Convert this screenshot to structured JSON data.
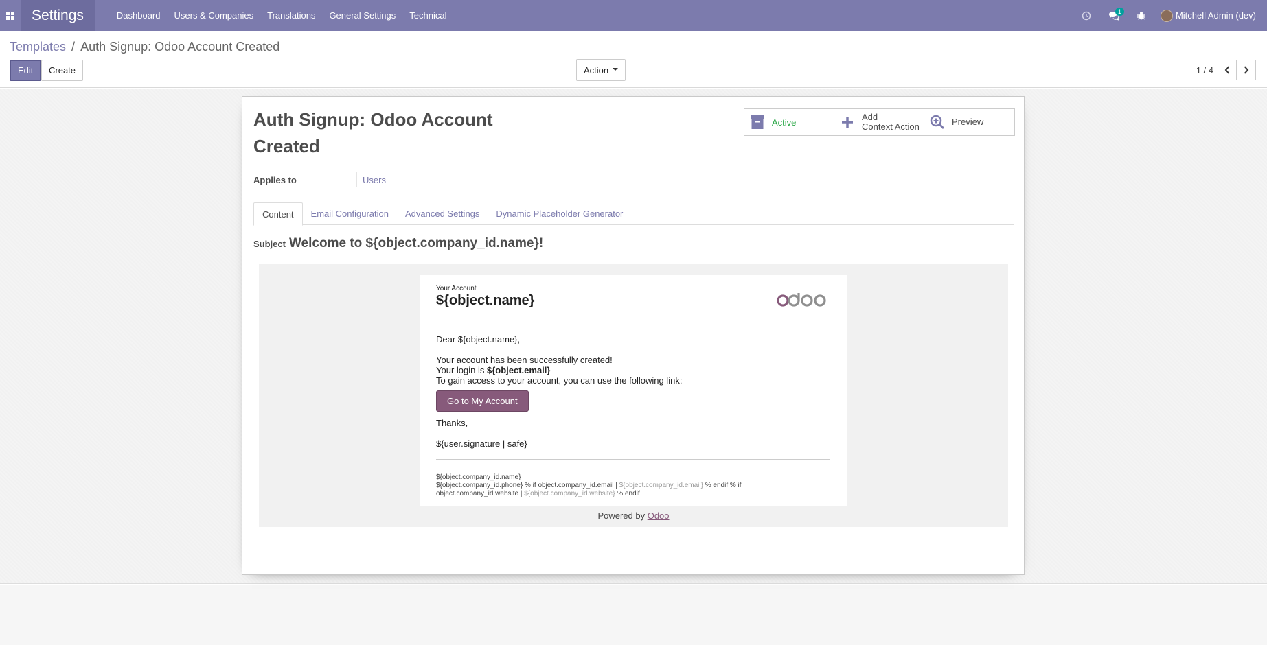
{
  "navbar": {
    "app_title": "Settings",
    "menu": [
      "Dashboard",
      "Users & Companies",
      "Translations",
      "General Settings",
      "Technical"
    ],
    "chat_badge": "1",
    "user_name": "Mitchell Admin (dev)"
  },
  "control_panel": {
    "breadcrumb_parent": "Templates",
    "breadcrumb_separator": "/",
    "breadcrumb_current": "Auth Signup: Odoo Account Created",
    "edit_label": "Edit",
    "create_label": "Create",
    "action_label": "Action",
    "pager_value": "1 / 4"
  },
  "form": {
    "title": "Auth Signup: Odoo Account Created",
    "buttons": {
      "active": "Active",
      "context_action_line1": "Add",
      "context_action_line2": "Context Action",
      "preview": "Preview"
    },
    "applies_to_label": "Applies to",
    "applies_to_value": "Users",
    "tabs": [
      "Content",
      "Email Configuration",
      "Advanced Settings",
      "Dynamic Placeholder Generator"
    ],
    "subject_label": "Subject",
    "subject_value": "Welcome to ${object.company_id.name}!"
  },
  "email": {
    "account_small": "Your Account",
    "account_name": "${object.name}",
    "logo_text": "odoo",
    "greeting": "Dear ${object.name},",
    "line1": "Your account has been successfully created!",
    "login_prefix": "Your login is ",
    "login_value": "${object.email}",
    "line3": "To gain access to your account, you can use the following link:",
    "button_label": "Go to My Account",
    "thanks": "Thanks,",
    "signature": "${user.signature | safe}",
    "footer_company": "${object.company_id.name}",
    "footer_phone": "${object.company_id.phone} % if object.company_id.email | ",
    "footer_email": "${object.company_id.email}",
    "footer_mid": " % endif % if",
    "footer_website_prefix": "object.company_id.website | ",
    "footer_website": "${object.company_id.website}",
    "footer_end": " % endif",
    "powered_prefix": "Powered by ",
    "powered_link": "Odoo"
  },
  "colors": {
    "brand": "#7c7bad",
    "odoo_purple": "#875a7b",
    "active_green": "#28a745"
  }
}
